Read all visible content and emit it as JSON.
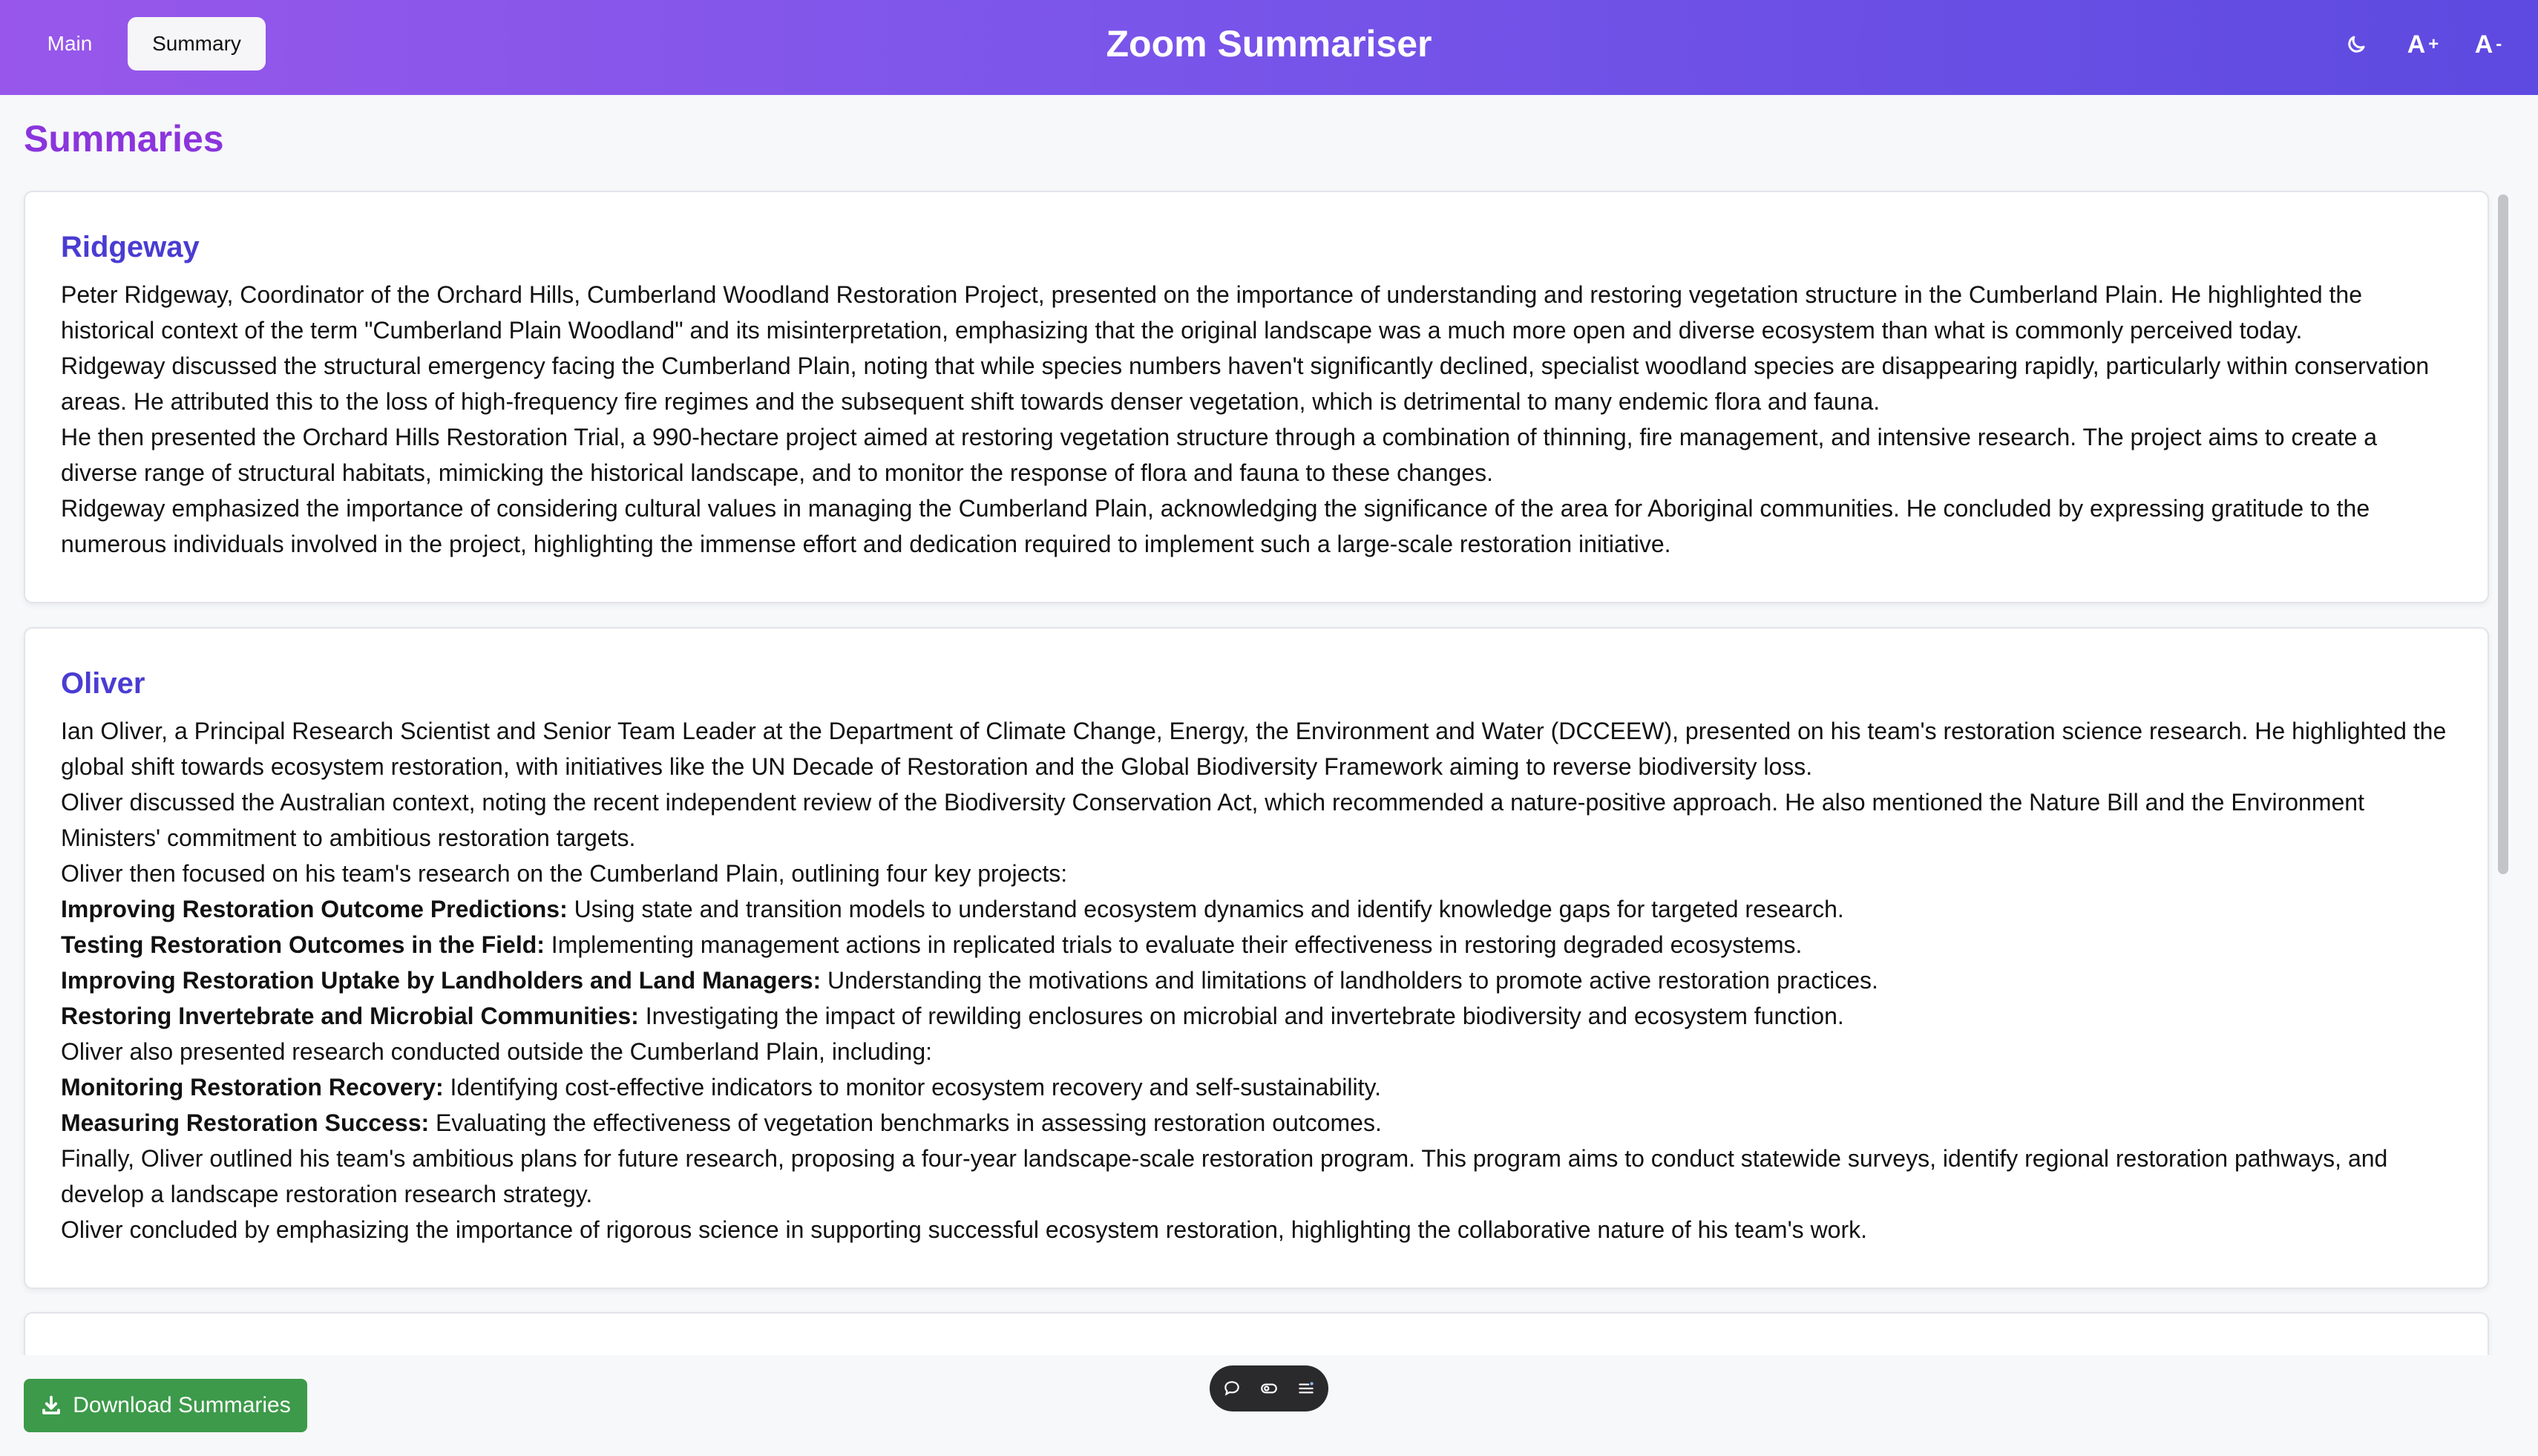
{
  "header": {
    "tabs": [
      {
        "label": "Main",
        "active": false
      },
      {
        "label": "Summary",
        "active": true
      }
    ],
    "title": "Zoom Summariser",
    "controls": {
      "theme_icon": "moon-icon",
      "font_increase_label": "A",
      "font_increase_symbol": "+",
      "font_decrease_label": "A",
      "font_decrease_symbol": "-"
    },
    "colors": {
      "gradient_start": "#9857ea",
      "gradient_end": "#5d4ae0"
    }
  },
  "page": {
    "title": "Summaries",
    "title_color": "#8b35dc",
    "name_color": "#4a3cd2"
  },
  "summaries": [
    {
      "name": "Ridgeway",
      "paragraphs": [
        "Peter Ridgeway, Coordinator of the Orchard Hills, Cumberland Woodland Restoration Project, presented on the importance of understanding and restoring vegetation structure in the Cumberland Plain. He highlighted the historical context of the term \"Cumberland Plain Woodland\" and its misinterpretation, emphasizing that the original landscape was a much more open and diverse ecosystem than what is commonly perceived today.",
        "Ridgeway discussed the structural emergency facing the Cumberland Plain, noting that while species numbers haven't significantly declined, specialist woodland species are disappearing rapidly, particularly within conservation areas. He attributed this to the loss of high-frequency fire regimes and the subsequent shift towards denser vegetation, which is detrimental to many endemic flora and fauna.",
        "He then presented the Orchard Hills Restoration Trial, a 990-hectare project aimed at restoring vegetation structure through a combination of thinning, fire management, and intensive research. The project aims to create a diverse range of structural habitats, mimicking the historical landscape, and to monitor the response of flora and fauna to these changes.",
        "Ridgeway emphasized the importance of considering cultural values in managing the Cumberland Plain, acknowledging the significance of the area for Aboriginal communities. He concluded by expressing gratitude to the numerous individuals involved in the project, highlighting the immense effort and dedication required to implement such a large-scale restoration initiative."
      ]
    },
    {
      "name": "Oliver",
      "paragraphs": [
        "Ian Oliver, a Principal Research Scientist and Senior Team Leader at the Department of Climate Change, Energy, the Environment and Water (DCCEEW), presented on his team's restoration science research. He highlighted the global shift towards ecosystem restoration, with initiatives like the UN Decade of Restoration and the Global Biodiversity Framework aiming to reverse biodiversity loss.",
        "Oliver discussed the Australian context, noting the recent independent review of the Biodiversity Conservation Act, which recommended a nature-positive approach. He also mentioned the Nature Bill and the Environment Ministers' commitment to ambitious restoration targets.",
        "Oliver then focused on his team's research on the Cumberland Plain, outlining four key projects:"
      ],
      "projects": [
        {
          "title": "Improving Restoration Outcome Predictions:",
          "text": " Using state and transition models to understand ecosystem dynamics and identify knowledge gaps for targeted research."
        },
        {
          "title": "Testing Restoration Outcomes in the Field:",
          "text": " Implementing management actions in replicated trials to evaluate their effectiveness in restoring degraded ecosystems."
        },
        {
          "title": "Improving Restoration Uptake by Landholders and Land Managers:",
          "text": " Understanding the motivations and limitations of landholders to promote active restoration practices."
        },
        {
          "title": "Restoring Invertebrate and Microbial Communities:",
          "text": " Investigating the impact of rewilding enclosures on microbial and invertebrate biodiversity and ecosystem function."
        }
      ],
      "outside_intro": "Oliver also presented research conducted outside the Cumberland Plain, including:",
      "outside": [
        {
          "title": "Monitoring Restoration Recovery:",
          "text": " Identifying cost-effective indicators to monitor ecosystem recovery and self-sustainability."
        },
        {
          "title": "Measuring Restoration Success:",
          "text": " Evaluating the effectiveness of vegetation benchmarks in assessing restoration outcomes."
        }
      ],
      "closing": [
        "Finally, Oliver outlined his team's ambitious plans for future research, proposing a four-year landscape-scale restoration program. This program aims to conduct statewide surveys, identify regional restoration pathways, and develop a landscape restoration research strategy.",
        "Oliver concluded by emphasizing the importance of rigorous science in supporting successful ecosystem restoration, highlighting the collaborative nature of his team's work."
      ]
    }
  ],
  "footer": {
    "download_label": "Download Summaries",
    "download_icon": "download-icon",
    "download_color": "#3d9a4a",
    "toolbar_icons": [
      "chat-bubble-icon",
      "eye-icon",
      "list-icon"
    ]
  }
}
